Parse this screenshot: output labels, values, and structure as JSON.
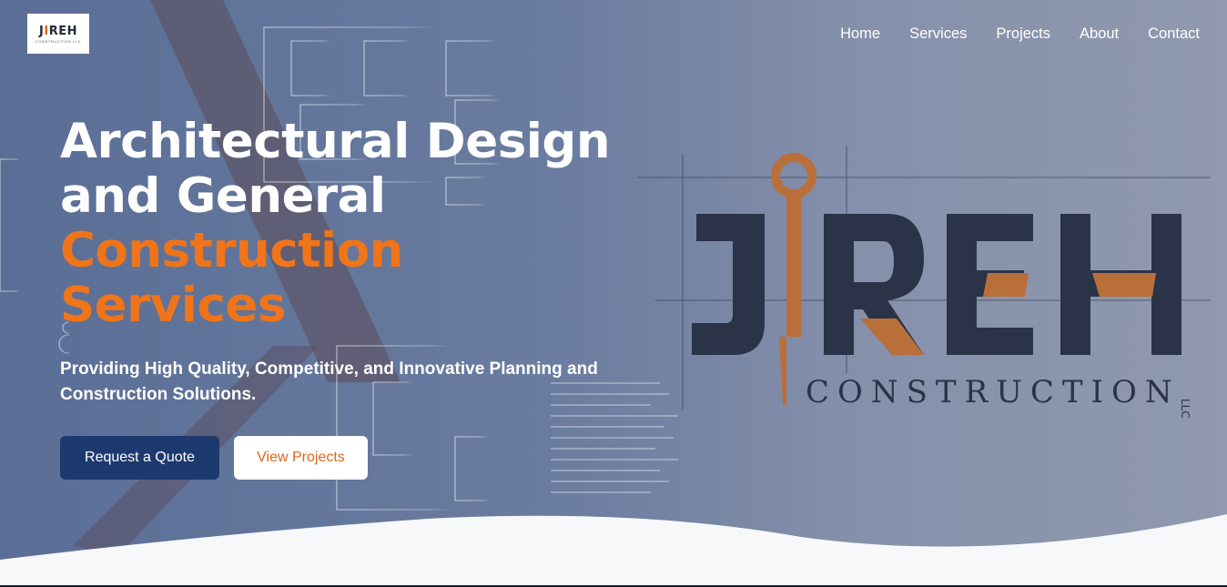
{
  "logo": {
    "text_main": "J",
    "text_accent": "I",
    "text_rest": "REH",
    "tagline": "CONSTRUCTION LLC"
  },
  "nav": [
    {
      "label": "Home"
    },
    {
      "label": "Services"
    },
    {
      "label": "Projects"
    },
    {
      "label": "About"
    },
    {
      "label": "Contact"
    }
  ],
  "hero": {
    "title_line1": "Architectural Design",
    "title_line2": "and General",
    "title_line3": "Construction",
    "title_line4": "Services",
    "subtitle": "Providing High Quality, Competitive, and Innovative Planning and Construction Solutions.",
    "cta_primary": "Request a Quote",
    "cta_secondary": "View Projects"
  },
  "brand_art": {
    "word": "JIREH",
    "sub": "CONSTRUCTION",
    "suffix": "LLC"
  },
  "colors": {
    "accent": "#f07419",
    "primary": "#1d3a6e",
    "brand_dark": "#2a3348",
    "bronze": "#b96f3a"
  }
}
